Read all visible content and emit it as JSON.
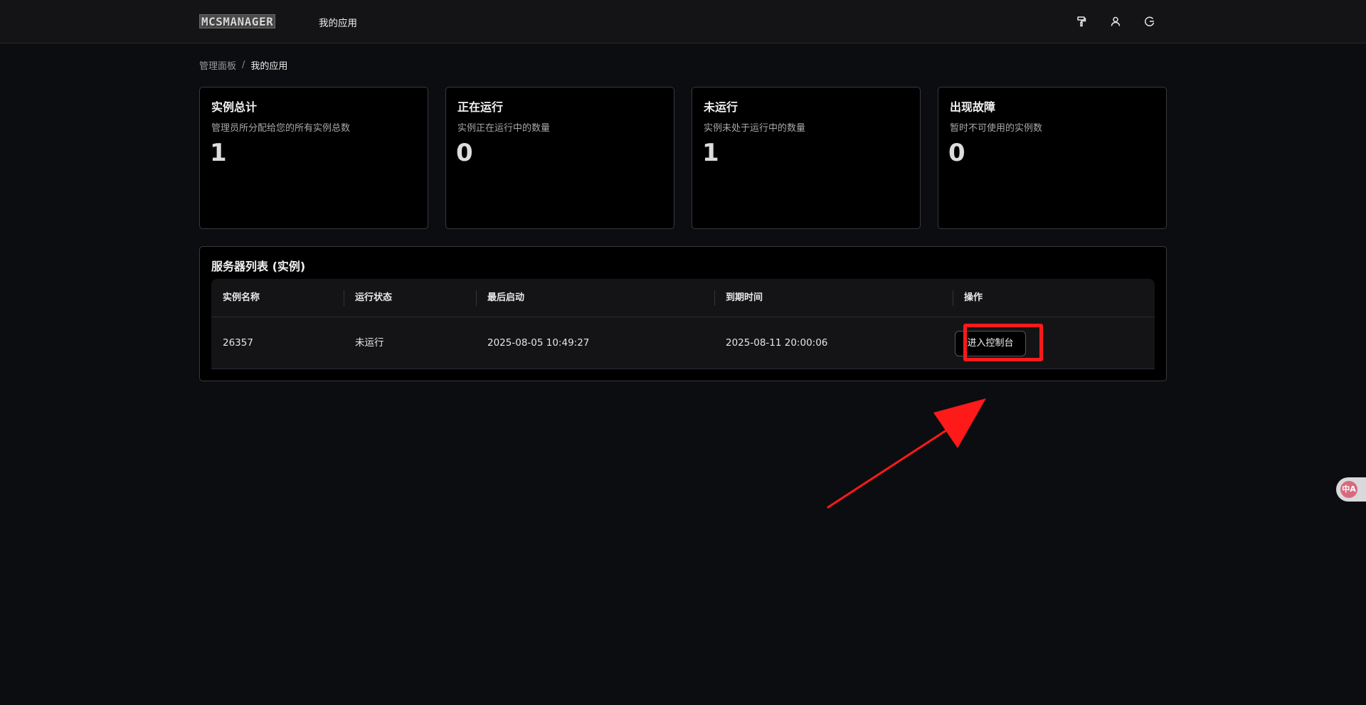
{
  "header": {
    "logo_text": "MCSMANAGER",
    "nav_app": "我的应用",
    "icons": [
      "paint-roller-icon",
      "user-icon",
      "logout-icon"
    ]
  },
  "breadcrumb": {
    "home": "管理面板",
    "separator": "/",
    "current": "我的应用"
  },
  "stats": [
    {
      "title": "实例总计",
      "desc": "管理员所分配给您的所有实例总数",
      "value": "1"
    },
    {
      "title": "正在运行",
      "desc": "实例正在运行中的数量",
      "value": "0"
    },
    {
      "title": "未运行",
      "desc": "实例未处于运行中的数量",
      "value": "1"
    },
    {
      "title": "出现故障",
      "desc": "暂时不可使用的实例数",
      "value": "0"
    }
  ],
  "server_list": {
    "title": "服务器列表 (实例)",
    "columns": [
      "实例名称",
      "运行状态",
      "最后启动",
      "到期时间",
      "操作"
    ],
    "rows": [
      {
        "name": "26357",
        "status": "未运行",
        "last_start": "2025-08-05 10:49:27",
        "expire": "2025-08-11 20:00:06",
        "action": "进入控制台"
      }
    ]
  },
  "translate_widget": {
    "icon": "translate-icon",
    "glyph": "中A"
  },
  "annotation": {
    "color": "#ff1a1a"
  }
}
